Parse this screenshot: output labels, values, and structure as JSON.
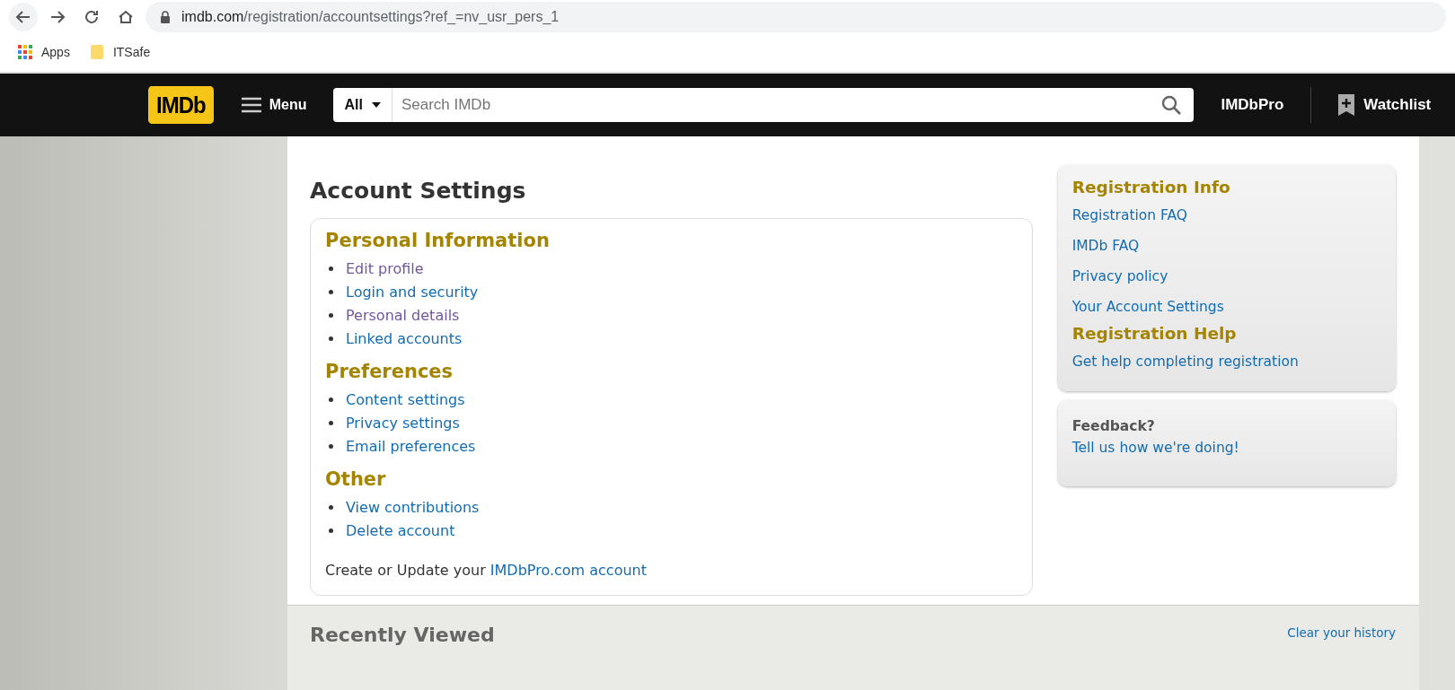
{
  "browser": {
    "url_host": "imdb.com",
    "url_path": "/registration/accountsettings?ref_=nv_usr_pers_1",
    "bookmarks": [
      {
        "kind": "apps",
        "label": "Apps"
      },
      {
        "kind": "folder",
        "label": "ITSafe"
      }
    ]
  },
  "header": {
    "logo": "IMDb",
    "menu": "Menu",
    "search_scope": "All",
    "search_placeholder": "Search IMDb",
    "pro": "IMDbPro",
    "watchlist": "Watchlist"
  },
  "title": "Account Settings",
  "sections": [
    {
      "heading": "Personal Information",
      "links": [
        {
          "label": "Edit profile",
          "visited": true
        },
        {
          "label": "Login and security",
          "visited": false
        },
        {
          "label": "Personal details",
          "visited": true
        },
        {
          "label": "Linked accounts",
          "visited": false
        }
      ]
    },
    {
      "heading": "Preferences",
      "links": [
        {
          "label": "Content settings",
          "visited": false
        },
        {
          "label": "Privacy settings",
          "visited": false
        },
        {
          "label": "Email preferences",
          "visited": false
        }
      ]
    },
    {
      "heading": "Other",
      "links": [
        {
          "label": "View contributions",
          "visited": false
        },
        {
          "label": "Delete account",
          "visited": false
        }
      ]
    }
  ],
  "pro_note": {
    "text": "Create or Update your",
    "link": "IMDbPro.com account"
  },
  "sidebar": [
    {
      "kind": "links",
      "sections": [
        {
          "heading": "Registration Info",
          "links": [
            "Registration FAQ",
            "IMDb FAQ",
            "Privacy policy",
            "Your Account Settings"
          ]
        },
        {
          "heading": "Registration Help",
          "links": [
            "Get help completing registration"
          ]
        }
      ]
    },
    {
      "kind": "feedback",
      "heading": "Feedback?",
      "link": "Tell us how we're doing!"
    }
  ],
  "recently_viewed": {
    "title": "Recently Viewed",
    "clear": "Clear your history"
  }
}
